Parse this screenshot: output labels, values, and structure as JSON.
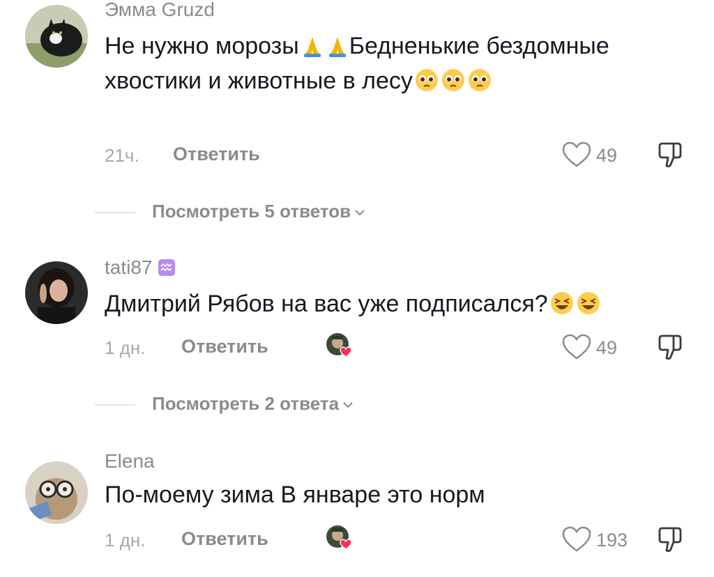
{
  "comments": [
    {
      "username": "Эмма Gruzd",
      "text_parts": [
        "Не нужно морозы",
        "Бедненькие бездомные хвостики и животные в лесу"
      ],
      "time": "21ч.",
      "reply_label": "Ответить",
      "likes": "49",
      "view_replies": "Посмотреть 5 ответов",
      "avatar": "cat-avatar"
    },
    {
      "username": "tati87",
      "badge": "aquarius-icon",
      "text": "Дмитрий Рябов на вас уже подписался?",
      "time": "1 дн.",
      "reply_label": "Ответить",
      "likes": "49",
      "view_replies": "Посмотреть 2 ответа",
      "avatar": "woman-avatar",
      "liked_by_creator": true
    },
    {
      "username": "Elena",
      "text": "По-моему зима В январе это норм",
      "time": "1 дн.",
      "reply_label": "Ответить",
      "likes": "193",
      "avatar": "cat-glasses-avatar",
      "liked_by_creator": true
    }
  ],
  "colors": {
    "text": "#161823",
    "secondary": "#8a8b91",
    "heart_badge": "#fe2c55",
    "pray_emoji": "#f4b400",
    "pleading_emoji": "#ffcc4d"
  }
}
